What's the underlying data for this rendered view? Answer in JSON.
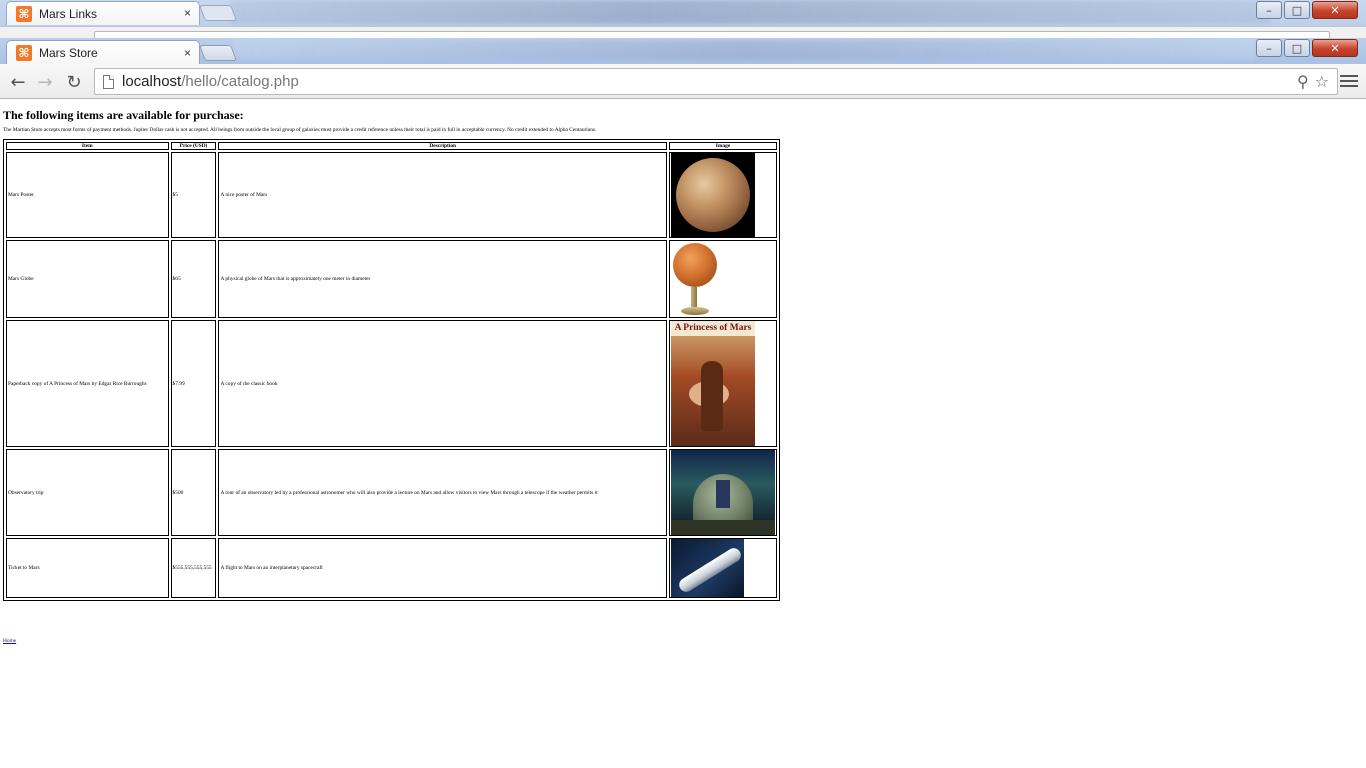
{
  "background_window": {
    "tab_title": "Mars Links",
    "tab_close": "×",
    "controls": {
      "minimize": "–",
      "maximize": "□",
      "close": "✕"
    }
  },
  "browser": {
    "tab_title": "Mars Store",
    "tab_close": "×",
    "url_host": "localhost",
    "url_path": "/hello/catalog.php",
    "controls": {
      "minimize": "–",
      "maximize": "□",
      "close": "✕"
    },
    "icons": {
      "back": "←",
      "forward": "→",
      "reload": "↻",
      "search": "⚲",
      "star": "☆",
      "favicon": "⌘"
    }
  },
  "page": {
    "heading": "The following items are available for purchase:",
    "intro": "The Martian Store accepts most forms of payment methods. Jupiter Dollar cash is not accepted. All beings from outside the local group of galaxies must provide a credit reference unless their total is paid in full in acceptable currency. No credit extended to Alpha Centaurians.",
    "table": {
      "headers": [
        "Item",
        "Price (USD)",
        "Description",
        "Image"
      ],
      "rows": [
        {
          "item": "Mars Poster",
          "price": "$5",
          "description": "A nice poster of Mars",
          "image": "mars-planet-photo"
        },
        {
          "item": "Mars Globe",
          "price": "$65",
          "description": "A physical globe of Mars that is approximately one meter in diameter",
          "image": "mars-globe-photo"
        },
        {
          "item": "Paperback copy of A Princess of Mars by Edgar Rice Burroughs",
          "price": "$7.99",
          "description": "A copy of the classic book",
          "image": "book-cover-photo",
          "image_text": "A Princess of Mars"
        },
        {
          "item": "Observatory trip",
          "price": "$500",
          "description": "A tour of an observatory led by a professional astronomer who will also provide a lecture on Mars and allow visitors to view Mars through a telescope if the weather permits it",
          "image": "observatory-photo"
        },
        {
          "item": "Ticket to Mars",
          "price": "$555,555,555,555",
          "description": "A flight to Mars on an interplanetary spacecraft",
          "image": "spacecraft-photo"
        }
      ]
    },
    "home_link": "Home"
  }
}
